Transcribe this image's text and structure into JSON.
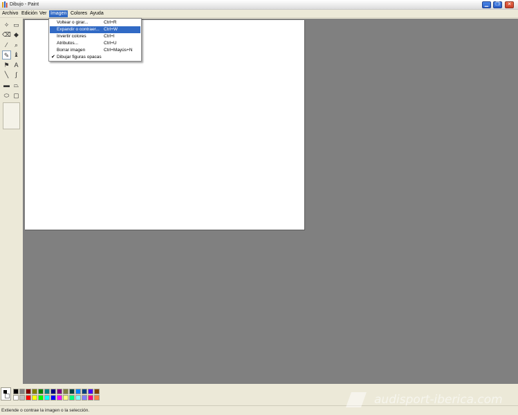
{
  "window": {
    "title": "Dibujo - Paint",
    "min_label": "▁",
    "restore_label": "❐",
    "close_label": "✕"
  },
  "menubar": [
    "Archivo",
    "Edición",
    "Ver",
    "Imagen",
    "Colores",
    "Ayuda"
  ],
  "active_menu": "Imagen",
  "dropdown": [
    {
      "label": "Voltear o girar...",
      "shortcut": "Ctrl+R",
      "highlighted": false,
      "checked": false
    },
    {
      "label": "Expandir o contraer...",
      "shortcut": "Ctrl+W",
      "highlighted": true,
      "checked": false
    },
    {
      "label": "Invertir colores",
      "shortcut": "Ctrl+I",
      "highlighted": false,
      "checked": false
    },
    {
      "label": "Atributos...",
      "shortcut": "Ctrl+U",
      "highlighted": false,
      "checked": false
    },
    {
      "label": "Borrar imagen",
      "shortcut": "Ctrl+Mayús+N",
      "highlighted": false,
      "checked": false
    },
    {
      "label": "Dibujar figuras opacas",
      "shortcut": "",
      "highlighted": false,
      "checked": true
    }
  ],
  "tools": [
    {
      "name": "free-select-icon",
      "glyph": "✧"
    },
    {
      "name": "rect-select-icon",
      "glyph": "▭"
    },
    {
      "name": "eraser-icon",
      "glyph": "⌫"
    },
    {
      "name": "fill-icon",
      "glyph": "◆"
    },
    {
      "name": "pick-color-icon",
      "glyph": "⁄"
    },
    {
      "name": "magnifier-icon",
      "glyph": "⌕"
    },
    {
      "name": "pencil-icon",
      "glyph": "✎"
    },
    {
      "name": "brush-icon",
      "glyph": "♝"
    },
    {
      "name": "airbrush-icon",
      "glyph": "⚑"
    },
    {
      "name": "text-icon",
      "glyph": "A"
    },
    {
      "name": "line-icon",
      "glyph": "╲"
    },
    {
      "name": "curve-icon",
      "glyph": "∫"
    },
    {
      "name": "rectangle-icon",
      "glyph": "▬"
    },
    {
      "name": "polygon-icon",
      "glyph": "⏢"
    },
    {
      "name": "ellipse-icon",
      "glyph": "⬭"
    },
    {
      "name": "rounded-rect-icon",
      "glyph": "▢"
    }
  ],
  "palette": {
    "top": [
      "#000000",
      "#808080",
      "#800000",
      "#808000",
      "#008000",
      "#008080",
      "#000080",
      "#800080",
      "#808040",
      "#004040",
      "#0080ff",
      "#004080",
      "#4000ff",
      "#804000"
    ],
    "bottom": [
      "#ffffff",
      "#c0c0c0",
      "#ff0000",
      "#ffff00",
      "#00ff00",
      "#00ffff",
      "#0000ff",
      "#ff00ff",
      "#ffff80",
      "#00ff80",
      "#80ffff",
      "#8080ff",
      "#ff0080",
      "#ff8040"
    ]
  },
  "status": "Extiende o contrae la imagen o la selección.",
  "watermark": "audisport-iberica.com"
}
